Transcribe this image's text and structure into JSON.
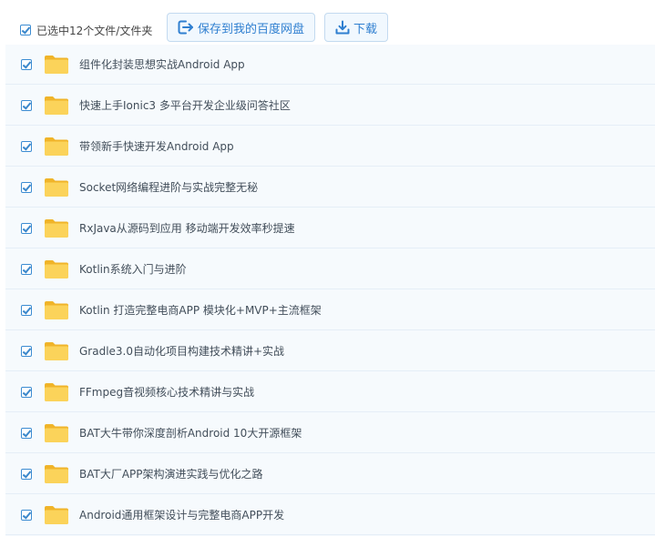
{
  "toolbar": {
    "selection_label": "已选中12个文件/文件夹",
    "save_label": "保存到我的百度网盘",
    "download_label": "下载",
    "save_icon": "save-to-cloud-icon",
    "download_icon": "download-icon"
  },
  "colors": {
    "accent": "#2f7fd0",
    "button_bg": "#f1f8fe",
    "row_bg": "#f6fafd",
    "folder": "#f9c940"
  },
  "files": [
    {
      "name": "组件化封装思想实战Android App",
      "checked": true,
      "icon": "folder-icon"
    },
    {
      "name": "快速上手Ionic3 多平台开发企业级问答社区",
      "checked": true,
      "icon": "folder-icon"
    },
    {
      "name": "带领新手快速开发Android App",
      "checked": true,
      "icon": "folder-icon"
    },
    {
      "name": "Socket网络编程进阶与实战完整无秘",
      "checked": true,
      "icon": "folder-icon"
    },
    {
      "name": "RxJava从源码到应用 移动端开发效率秒提速",
      "checked": true,
      "icon": "folder-icon"
    },
    {
      "name": "Kotlin系统入门与进阶",
      "checked": true,
      "icon": "folder-icon"
    },
    {
      "name": "Kotlin 打造完整电商APP 模块化+MVP+主流框架",
      "checked": true,
      "icon": "folder-icon"
    },
    {
      "name": "Gradle3.0自动化项目构建技术精讲+实战",
      "checked": true,
      "icon": "folder-icon"
    },
    {
      "name": "FFmpeg音视频核心技术精讲与实战",
      "checked": true,
      "icon": "folder-icon"
    },
    {
      "name": "BAT大牛带你深度剖析Android 10大开源框架",
      "checked": true,
      "icon": "folder-icon"
    },
    {
      "name": "BAT大厂APP架构演进实践与优化之路",
      "checked": true,
      "icon": "folder-icon"
    },
    {
      "name": "Android通用框架设计与完整电商APP开发",
      "checked": true,
      "icon": "folder-icon"
    }
  ]
}
